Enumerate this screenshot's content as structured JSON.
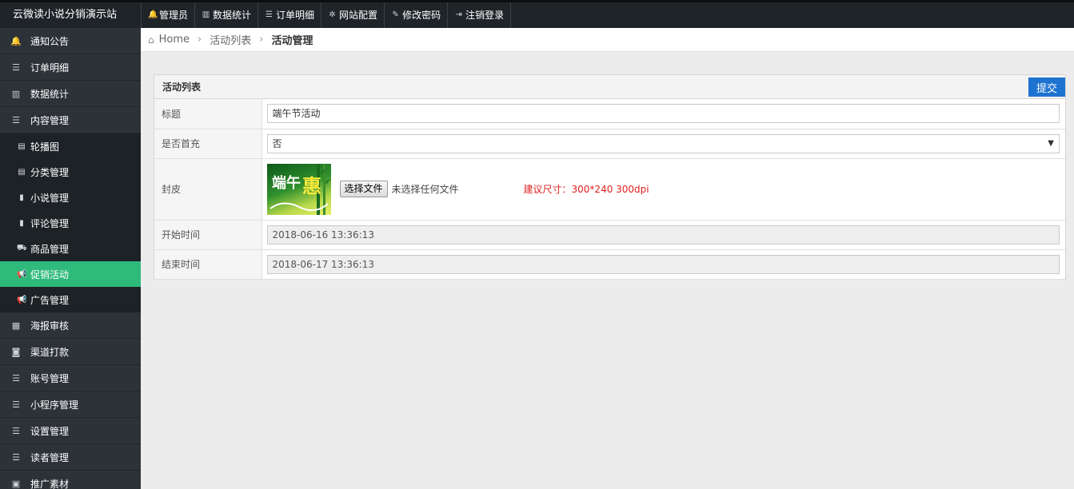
{
  "app": {
    "brand": "云微读小说分销演示站"
  },
  "topnav": [
    {
      "label": "管理员",
      "icon": "bell-icon",
      "glyph": "🔔"
    },
    {
      "label": "数据统计",
      "icon": "bar-chart-icon",
      "glyph": "▥"
    },
    {
      "label": "订单明细",
      "icon": "list-icon",
      "glyph": "☰"
    },
    {
      "label": "网站配置",
      "icon": "gear-icon",
      "glyph": "✲"
    },
    {
      "label": "修改密码",
      "icon": "edit-icon",
      "glyph": "✎"
    },
    {
      "label": "注销登录",
      "icon": "sign-out-icon",
      "glyph": "⇥"
    }
  ],
  "sidebar": {
    "items": [
      {
        "label": "通知公告",
        "icon": "bell-icon",
        "glyph": "🔔",
        "level": 1,
        "active": false
      },
      {
        "label": "订单明细",
        "icon": "list-icon",
        "glyph": "☰",
        "level": 1,
        "active": false
      },
      {
        "label": "数据统计",
        "icon": "bar-chart-icon",
        "glyph": "▥",
        "level": 1,
        "active": false
      },
      {
        "label": "内容管理",
        "icon": "list-icon",
        "glyph": "☰",
        "level": 1,
        "active": false
      },
      {
        "label": "轮播图",
        "icon": "list-alt-icon",
        "glyph": "▤",
        "level": 2,
        "active": false
      },
      {
        "label": "分类管理",
        "icon": "list-alt-icon",
        "glyph": "▤",
        "level": 2,
        "active": false
      },
      {
        "label": "小说管理",
        "icon": "book-icon",
        "glyph": "▮",
        "level": 2,
        "active": false
      },
      {
        "label": "评论管理",
        "icon": "book-icon",
        "glyph": "▮",
        "level": 2,
        "active": false
      },
      {
        "label": "商品管理",
        "icon": "truck-icon",
        "glyph": "⛟",
        "level": 2,
        "active": false
      },
      {
        "label": "促销活动",
        "icon": "bullhorn-icon",
        "glyph": "📢",
        "level": 2,
        "active": true
      },
      {
        "label": "广告管理",
        "icon": "bullhorn-icon",
        "glyph": "📢",
        "level": 2,
        "active": false
      },
      {
        "label": "海报审核",
        "icon": "grid-icon",
        "glyph": "▦",
        "level": 1,
        "active": false
      },
      {
        "label": "渠道打款",
        "icon": "money-icon",
        "glyph": "◙",
        "level": 1,
        "active": false
      },
      {
        "label": "账号管理",
        "icon": "list-icon",
        "glyph": "☰",
        "level": 1,
        "active": false
      },
      {
        "label": "小程序管理",
        "icon": "list-icon",
        "glyph": "☰",
        "level": 1,
        "active": false
      },
      {
        "label": "设置管理",
        "icon": "list-icon",
        "glyph": "☰",
        "level": 1,
        "active": false
      },
      {
        "label": "读者管理",
        "icon": "list-icon",
        "glyph": "☰",
        "level": 1,
        "active": false
      },
      {
        "label": "推广素材",
        "icon": "image-icon",
        "glyph": "▣",
        "level": 1,
        "active": false
      }
    ]
  },
  "breadcrumb": {
    "home": "Home",
    "list": "活动列表",
    "current": "活动管理"
  },
  "panel": {
    "title": "活动列表",
    "submit_label": "提交",
    "fields": {
      "title": {
        "label": "标题",
        "value": "端午节活动"
      },
      "first_recharge": {
        "label": "是否首充",
        "value": "否"
      },
      "cover": {
        "label": "封皮",
        "button": "选择文件",
        "status": "未选择任何文件",
        "hint": "建议尺寸：300*240  300dpi",
        "image_text_big": "端午",
        "image_text_small": "惠"
      },
      "start_time": {
        "label": "开始时间",
        "value": "2018-06-16 13:36:13"
      },
      "end_time": {
        "label": "结束时间",
        "value": "2018-06-17 13:36:13"
      }
    }
  }
}
